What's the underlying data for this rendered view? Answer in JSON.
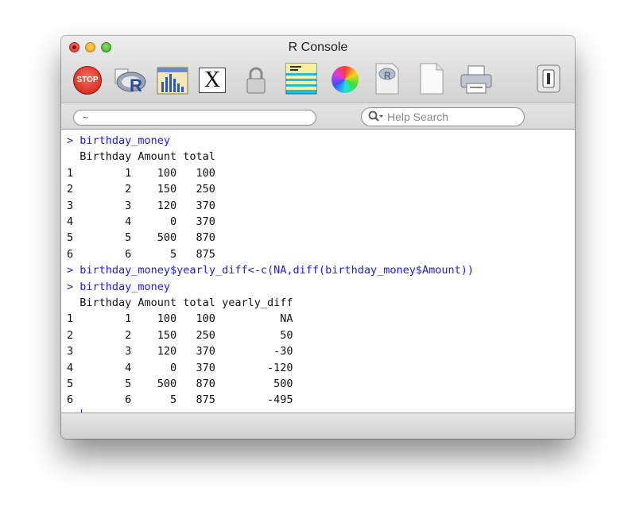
{
  "window": {
    "title": "R Console"
  },
  "toolbar": {
    "items": [
      {
        "name": "stop-icon",
        "label": "STOP"
      },
      {
        "name": "r-logo-icon"
      },
      {
        "name": "bar-chart-icon"
      },
      {
        "name": "x11-icon",
        "label": "X"
      },
      {
        "name": "lock-icon"
      },
      {
        "name": "stripes-icon"
      },
      {
        "name": "color-wheel-icon"
      },
      {
        "name": "r-document-icon"
      },
      {
        "name": "new-document-icon"
      },
      {
        "name": "printer-icon"
      },
      {
        "name": "toggle-icon"
      }
    ],
    "stop_label": "STOP",
    "x11_label": "X"
  },
  "pathbar": {
    "path_value": "~",
    "search_placeholder": "Help Search"
  },
  "console": {
    "lines": [
      {
        "prompt": ">",
        "text": "birthday_money",
        "kind": "cmd"
      },
      {
        "text": "  Birthday Amount total",
        "kind": "out"
      },
      {
        "text": "1        1    100   100",
        "kind": "out"
      },
      {
        "text": "2        2    150   250",
        "kind": "out"
      },
      {
        "text": "3        3    120   370",
        "kind": "out"
      },
      {
        "text": "4        4      0   370",
        "kind": "out"
      },
      {
        "text": "5        5    500   870",
        "kind": "out"
      },
      {
        "text": "6        6      5   875",
        "kind": "out"
      },
      {
        "prompt": ">",
        "text": "birthday_money$yearly_diff<-c(NA,diff(birthday_money$Amount))",
        "kind": "cmd"
      },
      {
        "prompt": ">",
        "text": "birthday_money",
        "kind": "cmd"
      },
      {
        "text": "  Birthday Amount total yearly_diff",
        "kind": "out"
      },
      {
        "text": "1        1    100   100          NA",
        "kind": "out"
      },
      {
        "text": "2        2    150   250          50",
        "kind": "out"
      },
      {
        "text": "3        3    120   370         -30",
        "kind": "out"
      },
      {
        "text": "4        4      0   370        -120",
        "kind": "out"
      },
      {
        "text": "5        5    500   870         500",
        "kind": "out"
      },
      {
        "text": "6        6      5   875        -495",
        "kind": "out"
      },
      {
        "prompt": ">",
        "text": "",
        "kind": "cmd",
        "cursor": true
      }
    ]
  },
  "colors": {
    "command_text": "#2020d8",
    "output_text": "#111111",
    "console_bg": "#ffffff"
  }
}
